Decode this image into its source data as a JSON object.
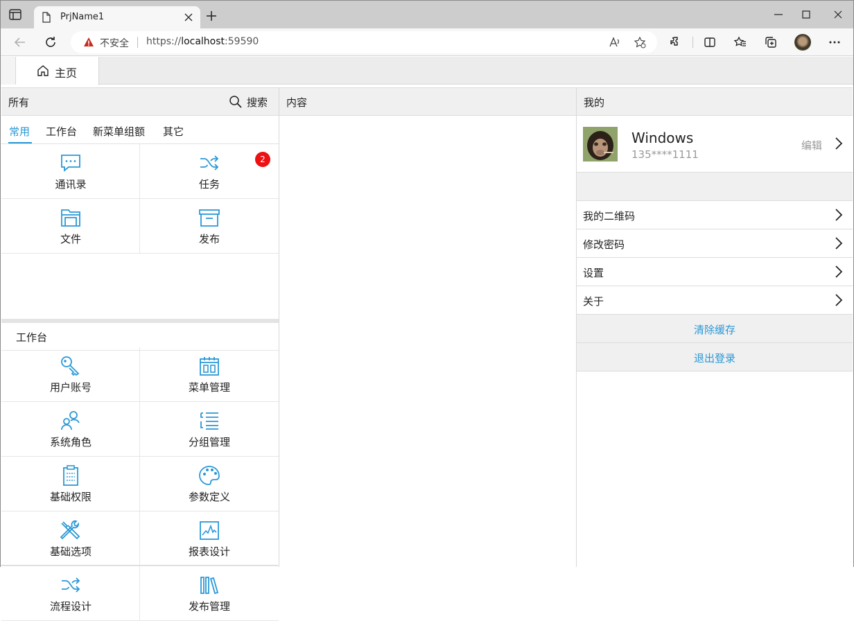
{
  "browser": {
    "tab_title": "PrjName1",
    "insecure_label": "不安全",
    "url_prefix": "https://",
    "url_host": "localhost",
    "url_port": ":59590"
  },
  "app_tabs": [
    {
      "label": "主页",
      "icon": "home-icon"
    }
  ],
  "left_panel": {
    "title": "所有",
    "search_label": "搜索",
    "categories": [
      "常用",
      "工作台",
      "新菜单组额",
      "其它"
    ],
    "active_category": "常用",
    "favorites": [
      {
        "label": "通讯录",
        "icon": "chat-icon"
      },
      {
        "label": "任务",
        "icon": "shuffle-icon",
        "badge": "2"
      },
      {
        "label": "文件",
        "icon": "folder-icon"
      },
      {
        "label": "发布",
        "icon": "archive-icon"
      }
    ],
    "workbench_title": "工作台",
    "workbench": [
      {
        "label": "用户账号",
        "icon": "key-icon"
      },
      {
        "label": "菜单管理",
        "icon": "calendar-icon"
      },
      {
        "label": "系统角色",
        "icon": "users-icon"
      },
      {
        "label": "分组管理",
        "icon": "list-icon"
      },
      {
        "label": "基础权限",
        "icon": "clipboard-icon"
      },
      {
        "label": "参数定义",
        "icon": "palette-icon"
      },
      {
        "label": "基础选项",
        "icon": "tools-icon"
      },
      {
        "label": "报表设计",
        "icon": "chart-icon"
      },
      {
        "label": "流程设计",
        "icon": "shuffle-icon"
      },
      {
        "label": "发布管理",
        "icon": "library-icon"
      }
    ]
  },
  "middle_panel": {
    "title": "内容"
  },
  "right_panel": {
    "title": "我的",
    "user_name": "Windows",
    "user_phone": "135****1111",
    "edit_label": "编辑",
    "menu": [
      "我的二维码",
      "修改密码",
      "设置",
      "关于"
    ],
    "actions": [
      "清除缓存",
      "退出登录"
    ]
  },
  "colors": {
    "accent": "#2a98d6",
    "badge": "#ee1111"
  }
}
